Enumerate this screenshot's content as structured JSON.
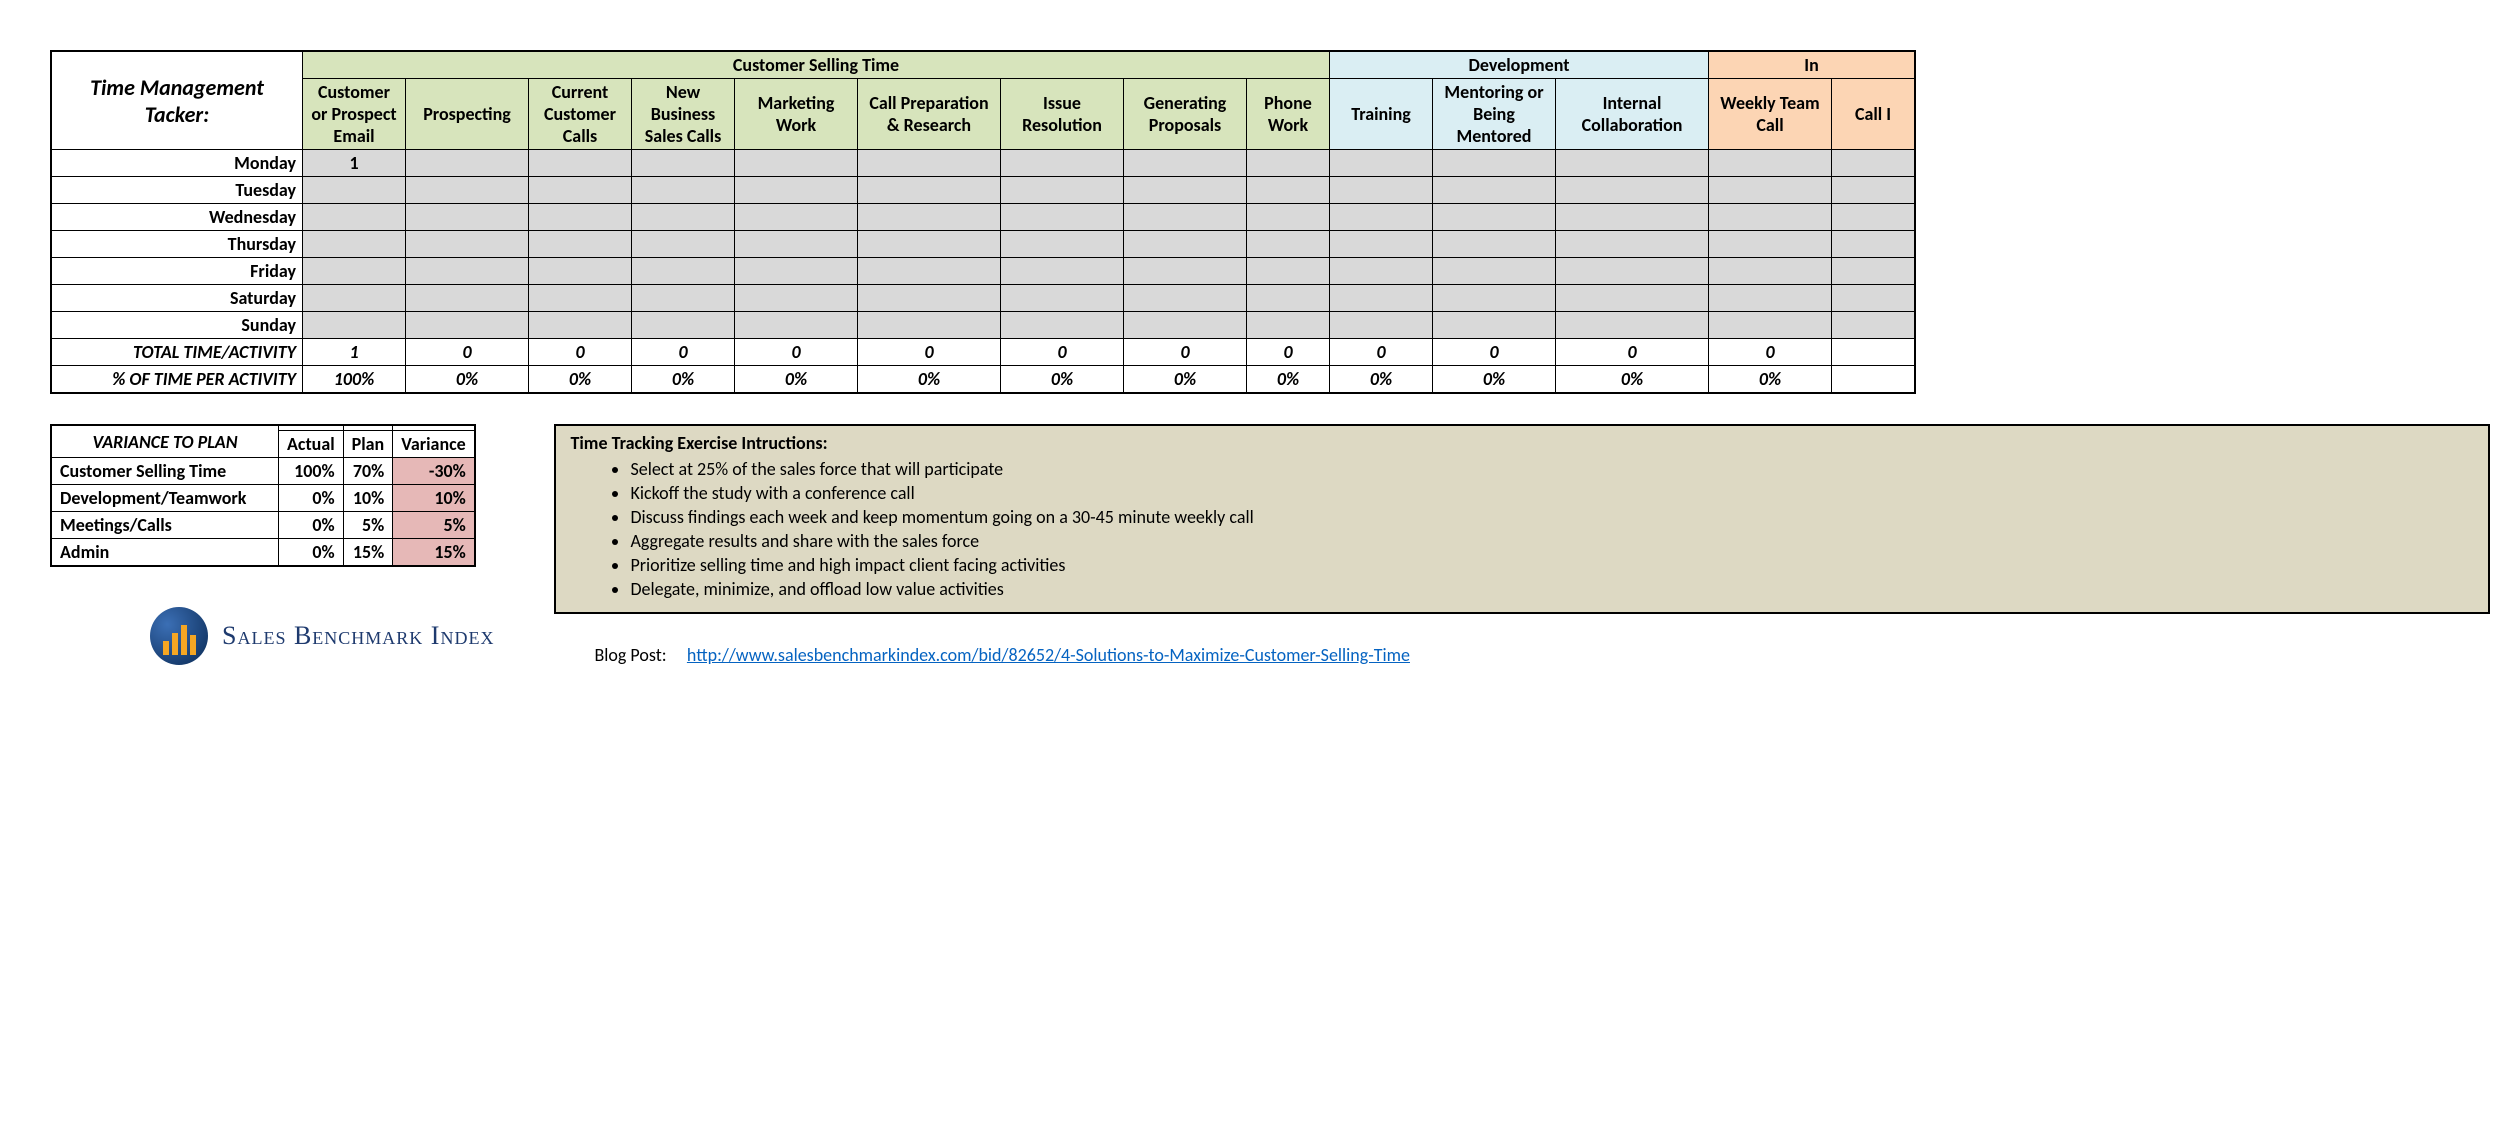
{
  "title": "Time Management Tacker:",
  "groups": {
    "g1": "Customer Selling Time",
    "g2": "Development",
    "g3": "In"
  },
  "columns": {
    "c0": "Customer or Prospect Email",
    "c1": "Prospecting",
    "c2": "Current Customer Calls",
    "c3": "New Business Sales Calls",
    "c4": "Marketing Work",
    "c5": "Call Preparation & Research",
    "c6": "Issue Resolution",
    "c7": "Generating Proposals",
    "c8": "Phone Work",
    "c9": "Training",
    "c10": "Mentoring or Being Mentored",
    "c11": "Internal Collaboration",
    "c12": "Weekly Team Call",
    "c13": "Call I"
  },
  "days": {
    "d0": "Monday",
    "d1": "Tuesday",
    "d2": "Wednesday",
    "d3": "Thursday",
    "d4": "Friday",
    "d5": "Saturday",
    "d6": "Sunday"
  },
  "monday_c0": "1",
  "totals_label": "TOTAL TIME/ACTIVITY",
  "totals": {
    "c0": "1",
    "c1": "0",
    "c2": "0",
    "c3": "0",
    "c4": "0",
    "c5": "0",
    "c6": "0",
    "c7": "0",
    "c8": "0",
    "c9": "0",
    "c10": "0",
    "c11": "0",
    "c12": "0"
  },
  "pct_label": "% OF TIME PER ACTIVITY",
  "pct": {
    "c0": "100%",
    "c1": "0%",
    "c2": "0%",
    "c3": "0%",
    "c4": "0%",
    "c5": "0%",
    "c6": "0%",
    "c7": "0%",
    "c8": "0%",
    "c9": "0%",
    "c10": "0%",
    "c11": "0%",
    "c12": "0%"
  },
  "variance": {
    "title": "VARIANCE TO PLAN",
    "h_actual": "Actual",
    "h_plan": "Plan",
    "h_var": "Variance",
    "rows": {
      "r0": {
        "label": "Customer Selling Time",
        "actual": "100%",
        "plan": "70%",
        "var": "-30%"
      },
      "r1": {
        "label": "Development/Teamwork",
        "actual": "0%",
        "plan": "10%",
        "var": "10%"
      },
      "r2": {
        "label": "Meetings/Calls",
        "actual": "0%",
        "plan": "5%",
        "var": "5%"
      },
      "r3": {
        "label": "Admin",
        "actual": "0%",
        "plan": "15%",
        "var": "15%"
      }
    }
  },
  "instructions": {
    "title": "Time Tracking Exercise Intructions:",
    "i0": "Select at 25% of the sales force that will participate",
    "i1": "Kickoff the study with a conference call",
    "i2": "Discuss findings each week and keep momentum going on a 30-45 minute weekly call",
    "i3": "Aggregate results and share with the sales force",
    "i4": "Prioritize selling time and high impact client facing activities",
    "i5": "Delegate, minimize, and offload low value activities"
  },
  "logo_text": "Sales Benchmark Index",
  "blog_label": "Blog Post:",
  "blog_url": "http://www.salesbenchmarkindex.com/bid/82652/4-Solutions-to-Maximize-Customer-Selling-Time"
}
